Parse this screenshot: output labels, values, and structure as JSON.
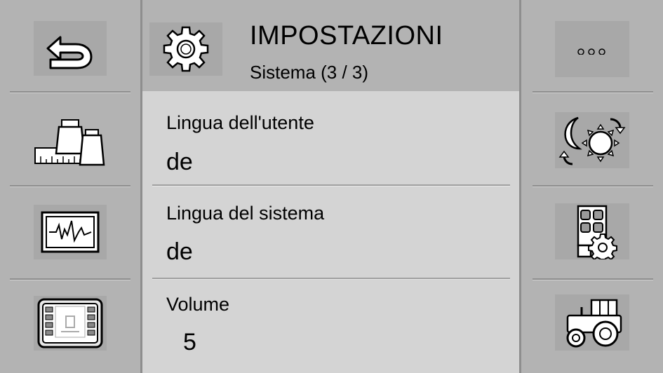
{
  "header": {
    "title": "IMPOSTAZIONI",
    "subtitle": "Sistema (3 / 3)",
    "icon": "gear-icon"
  },
  "items": [
    {
      "label": "Lingua dell'utente",
      "value": "de"
    },
    {
      "label": "Lingua del sistema",
      "value": "de"
    },
    {
      "label": "Volume",
      "value": "5"
    }
  ],
  "left_buttons": [
    "back-arrow-icon",
    "weights-scale-icon",
    "ecg-monitor-icon",
    "terminal-screen-icon"
  ],
  "right_buttons": [
    {
      "icon": "more-dots-icon",
      "label": "..."
    },
    {
      "icon": "day-night-icon"
    },
    {
      "icon": "keypad-settings-icon"
    },
    {
      "icon": "tractor-icon"
    }
  ],
  "colors": {
    "background": "#b3b3b3",
    "content": "#d4d4d4",
    "separator": "#8e8e8e"
  }
}
